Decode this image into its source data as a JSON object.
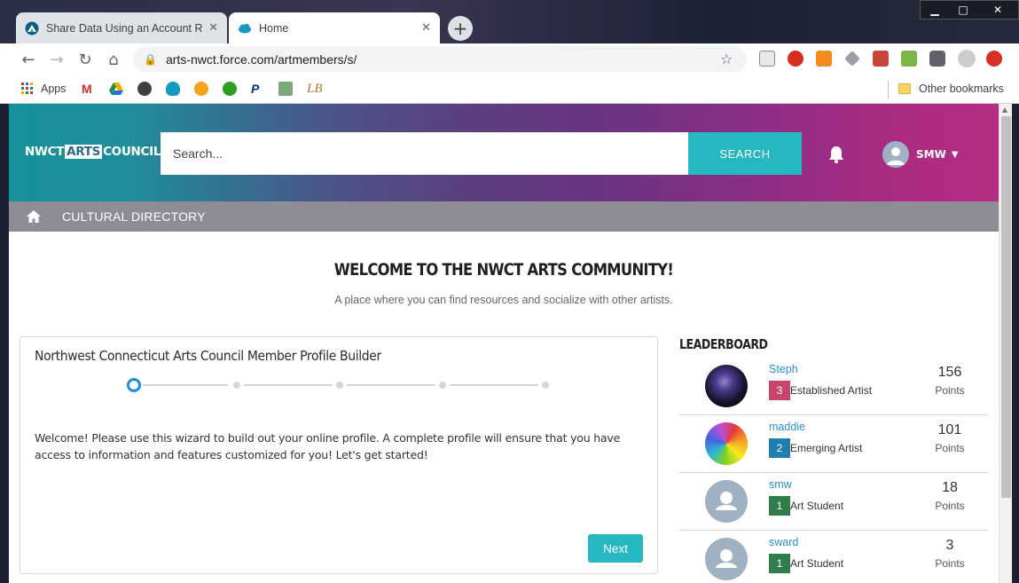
{
  "browser": {
    "tabs": [
      {
        "title": "Share Data Using an Account Rel",
        "active": false
      },
      {
        "title": "Home",
        "active": true
      }
    ],
    "url": "arts-nwct.force.com/artmembers/s/",
    "bookmarks": {
      "apps_label": "Apps",
      "other_label": "Other bookmarks"
    },
    "window_controls": {
      "minimize": "▁",
      "maximize": "□",
      "close": "✕"
    }
  },
  "header": {
    "logo": {
      "part1": "NWCT",
      "part2": "ARTS",
      "part3": "COUNCIL"
    },
    "search": {
      "placeholder": "Search...",
      "button_label": "SEARCH"
    },
    "user": {
      "name": "SMW"
    }
  },
  "subnav": {
    "directory_label": "CULTURAL DIRECTORY"
  },
  "welcome": {
    "title": "WELCOME TO THE NWCT ARTS COMMUNITY!",
    "subtitle": "A place where you can find resources and socialize with other artists."
  },
  "wizard": {
    "title": "Northwest Connecticut Arts Council Member Profile Builder",
    "steps_total": 5,
    "current_step": 1,
    "text": "Welcome! Please use this wizard to build out your online profile. A complete profile will ensure that you have access to information and features customized for you! Let's get started!",
    "next_label": "Next"
  },
  "leaderboard": {
    "title": "LEADERBOARD",
    "entries": [
      {
        "name": "Steph",
        "level": "3",
        "level_name": "Established Artist",
        "points": "156",
        "points_label": "Points",
        "badge_color": "#c8456a"
      },
      {
        "name": "maddie",
        "level": "2",
        "level_name": "Emerging Artist",
        "points": "101",
        "points_label": "Points",
        "badge_color": "#1e7fae"
      },
      {
        "name": "smw",
        "level": "1",
        "level_name": "Art Student",
        "points": "18",
        "points_label": "Points",
        "badge_color": "#2f7d4a"
      },
      {
        "name": "sward",
        "level": "1",
        "level_name": "Art Student",
        "points": "3",
        "points_label": "Points",
        "badge_color": "#2f7d4a"
      }
    ]
  },
  "colors": {
    "accent": "#25b8c0",
    "link": "#2a8fc7",
    "step_active": "#1c8fd6"
  }
}
